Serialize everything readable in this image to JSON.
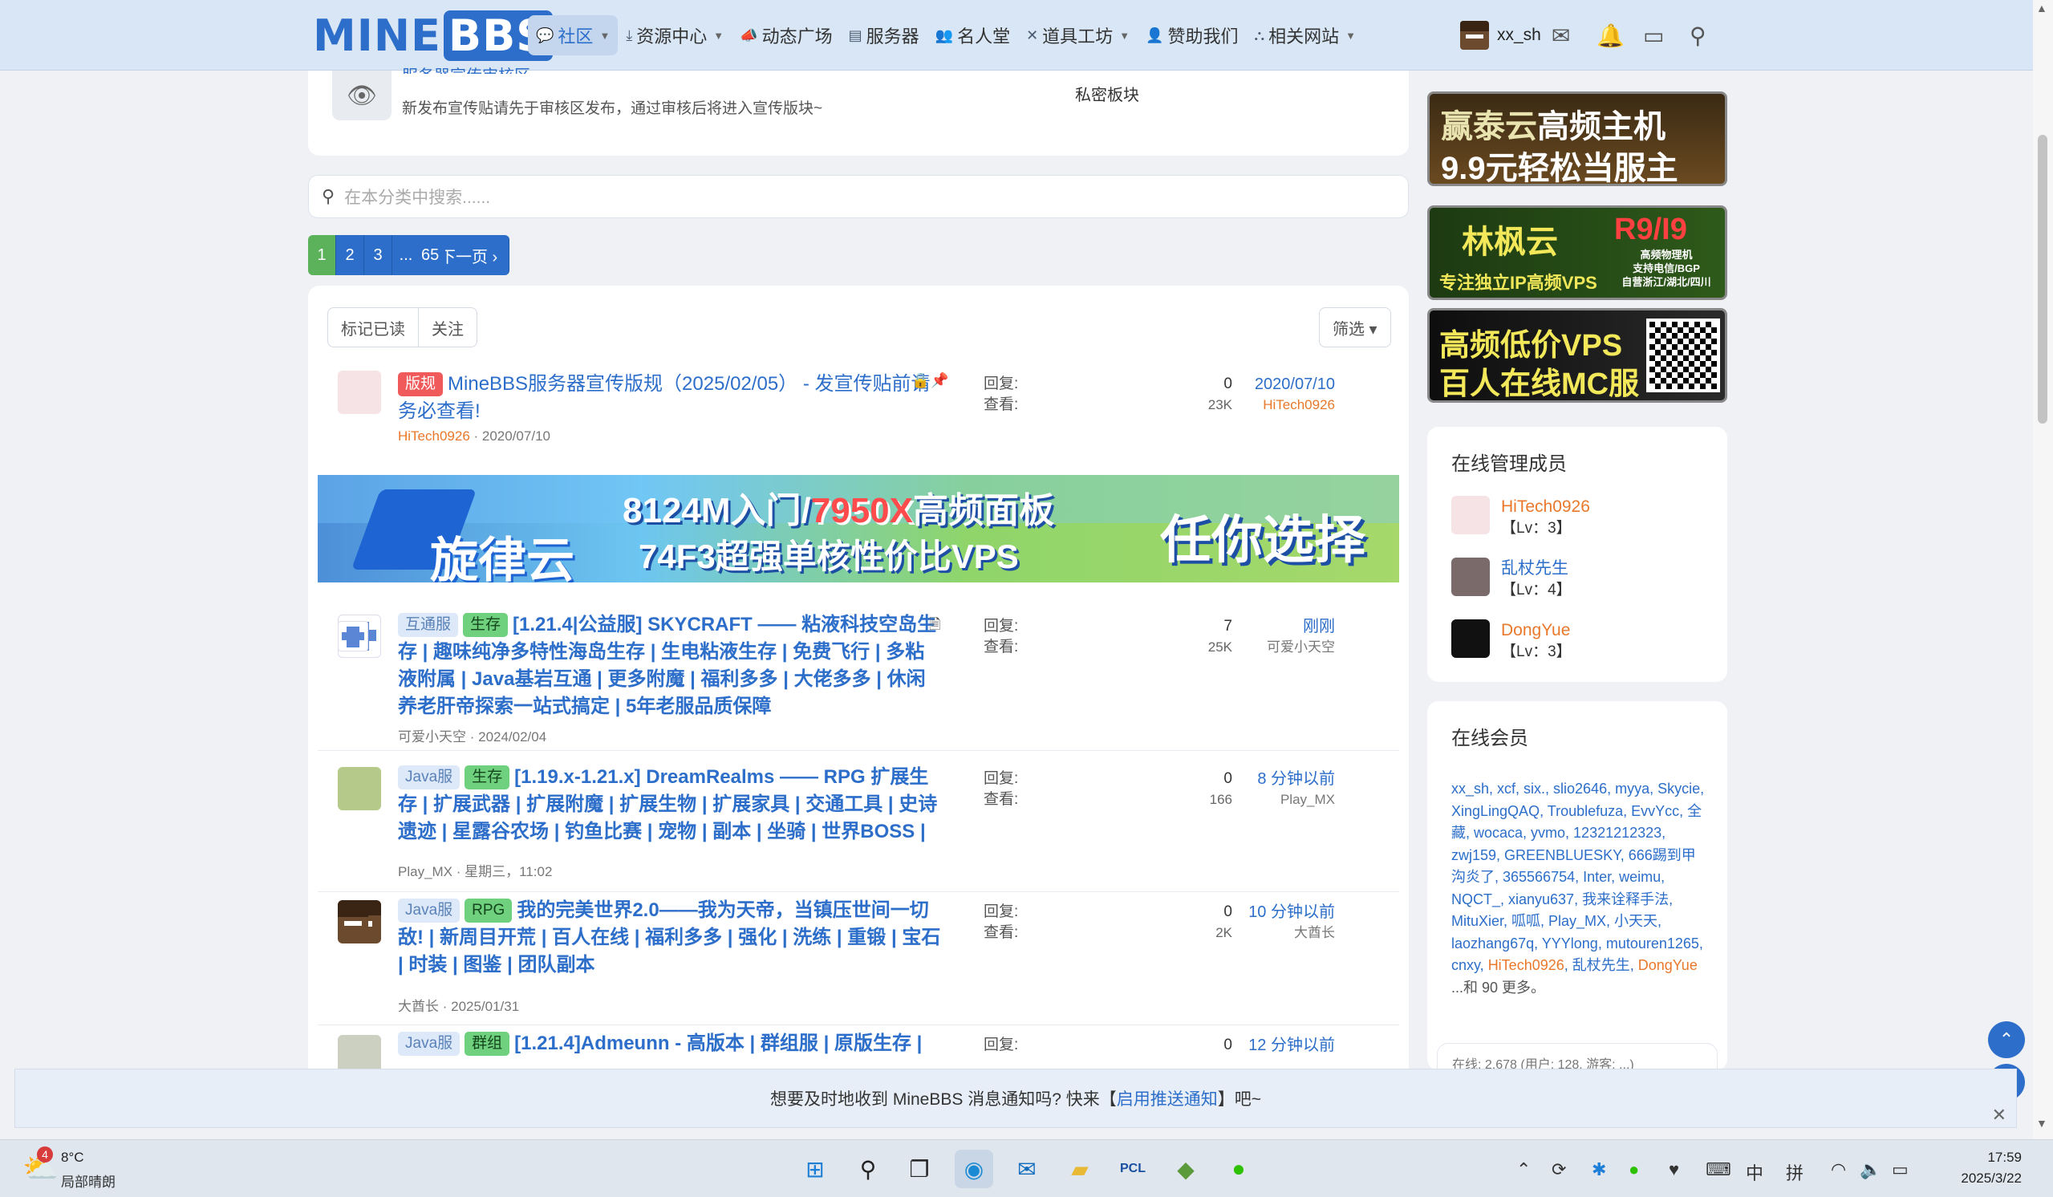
{
  "nav": {
    "logo_left": "MINE",
    "logo_right": "BBS",
    "items": [
      {
        "label": "社区",
        "icon": "chat-icon",
        "dropdown": true,
        "active": true
      },
      {
        "label": "资源中心",
        "icon": "download-icon",
        "dropdown": true
      },
      {
        "label": "动态广场",
        "icon": "megaphone-icon"
      },
      {
        "label": "服务器",
        "icon": "server-icon"
      },
      {
        "label": "名人堂",
        "icon": "users-icon"
      },
      {
        "label": "道具工坊",
        "icon": "tools-icon",
        "dropdown": true
      },
      {
        "label": "赞助我们",
        "icon": "donate-icon"
      },
      {
        "label": "相关网站",
        "icon": "sitemap-icon",
        "dropdown": true
      }
    ],
    "username": "xx_sh"
  },
  "audit": {
    "title": "服务器宣传审核区",
    "desc": "新发布宣传贴请先于审核区发布，通过审核后将进入宣传版块~",
    "private": "私密板块"
  },
  "search": {
    "placeholder": "在本分类中搜索......"
  },
  "pager": {
    "pages": [
      "1",
      "2",
      "3",
      "...",
      "65"
    ],
    "next": "下一页 ›"
  },
  "toolbar": {
    "mark_read": "标记已读",
    "follow": "关注",
    "filter": "筛选 ▾"
  },
  "labels": {
    "replies": "回复:",
    "views": "查看:"
  },
  "threads": [
    {
      "prefix": "版规",
      "prefix2": "",
      "title": "MineBBS服务器宣传版规（2025/02/05） - 发宣传贴前请务必查看!",
      "author": "HiTech0926",
      "date": "2020/07/10",
      "replies": "0",
      "views": "23K",
      "last_date": "2020/07/10",
      "last_user": "HiTech0926"
    },
    {
      "prefix": "互通服",
      "prefix2": "生存",
      "title": "[1.21.4|公益服] SKYCRAFT —— 粘液科技空岛生存 | 趣味纯净多特性海岛生存 | 生电粘液生存 | 免费飞行 | 多粘液附属 | Java基岩互通 | 更多附魔 | 福利多多 | 大佬多多 | 休闲养老肝帝探索一站式搞定 |  5年老服品质保障",
      "author": "可爱小天空",
      "date": "2024/02/04",
      "replies": "7",
      "views": "25K",
      "last_date": "刚刚",
      "last_user": "可爱小天空"
    },
    {
      "prefix": "Java服",
      "prefix2": "生存",
      "title": "[1.19.x-1.21.x] DreamRealms —— RPG 扩展生存 | 扩展武器 | 扩展附魔 | 扩展生物 | 扩展家具 | 交通工具 | 史诗遗迹 | 星露谷农场 | 钓鱼比赛 | 宠物 | 副本 | 坐骑 | 世界BOSS |",
      "author": "Play_MX",
      "date": "星期三，11:02",
      "replies": "0",
      "views": "166",
      "last_date": "8 分钟以前",
      "last_user": "Play_MX"
    },
    {
      "prefix": "Java服",
      "prefix2": "RPG",
      "title": "我的完美世界2.0——我为天帝，当镇压世间一切敌! | 新周目开荒 | 百人在线 | 福利多多 | 强化 | 洗练 | 重锻 | 宝石 | 时装 | 图鉴 | 团队副本",
      "author": "大酋长",
      "date": "2025/01/31",
      "replies": "0",
      "views": "2K",
      "last_date": "10 分钟以前",
      "last_user": "大酋长"
    },
    {
      "prefix": "Java服",
      "prefix2": "群组",
      "title": "[1.21.4]Admeunn - 高版本 | 群组服 | 原版生存 |",
      "author": "",
      "date": "",
      "replies": "0",
      "views": "",
      "last_date": "12 分钟以前",
      "last_user": ""
    }
  ],
  "banner": {
    "line1a": "8124M入门/",
    "line1b": "7950X",
    "line1c": "高频面板",
    "line2": "74F3超强单核性价比VPS",
    "brand": "旋律云",
    "slogan": "任你选择"
  },
  "ads": [
    {
      "t1": "赢泰云",
      "t2": "高频主机",
      "t3": "9.9元轻松当服主"
    },
    {
      "t1": "林枫云",
      "t2": "R9/I9",
      "t3": "专注独立IP高频VPS",
      "t4": "高频物理机",
      "t5": "支持电信/BGP",
      "t6": "自营浙江/湖北/四川"
    },
    {
      "t1": "高频低价VPS",
      "t2": "百人在线MC服"
    }
  ],
  "staff": {
    "title": "在线管理成员",
    "list": [
      {
        "name": "HiTech0926",
        "level": "【Lv：3】",
        "color": "#e9782b"
      },
      {
        "name": "乱杖先生",
        "level": "【Lv：4】",
        "color": "#2c6ec9"
      },
      {
        "name": "DongYue",
        "level": "【Lv：3】",
        "color": "#e9782b"
      }
    ]
  },
  "members": {
    "title": "在线会员",
    "text": "xx_sh, xcf, six., slio2646, myya, Skycie, XingLingQAQ, Troublefuza, EvvYcc, 全藏, wocaca, yvmo, 12321212323, zwj159, GREENBLUESKY, 666踢到甲沟炎了, 365566754, Inter, weimu, NQCT_, xianyu637, 我来诠释手法, MituXier, 呱呱, Play_MX, 小天天, laozhang67q, YYYlong, mutouren1265, cnxy, ",
    "orange1": "HiTech0926",
    "mid": ", 乱杖先生, ",
    "orange2": "DongYue",
    "more": "...和 90 更多。",
    "stats": "在线: 2,678 (用户: 128, 游客: ...)"
  },
  "notice": {
    "pre": "想要及时地收到 MineBBS 消息通知吗? 快来【",
    "link": "启用推送通知",
    "post": "】吧~"
  },
  "taskbar": {
    "temp": "8°C",
    "weather": "局部晴朗",
    "badge": "4",
    "time": "17:59",
    "date": "2025/3/22",
    "ime1": "中",
    "ime2": "拼"
  }
}
